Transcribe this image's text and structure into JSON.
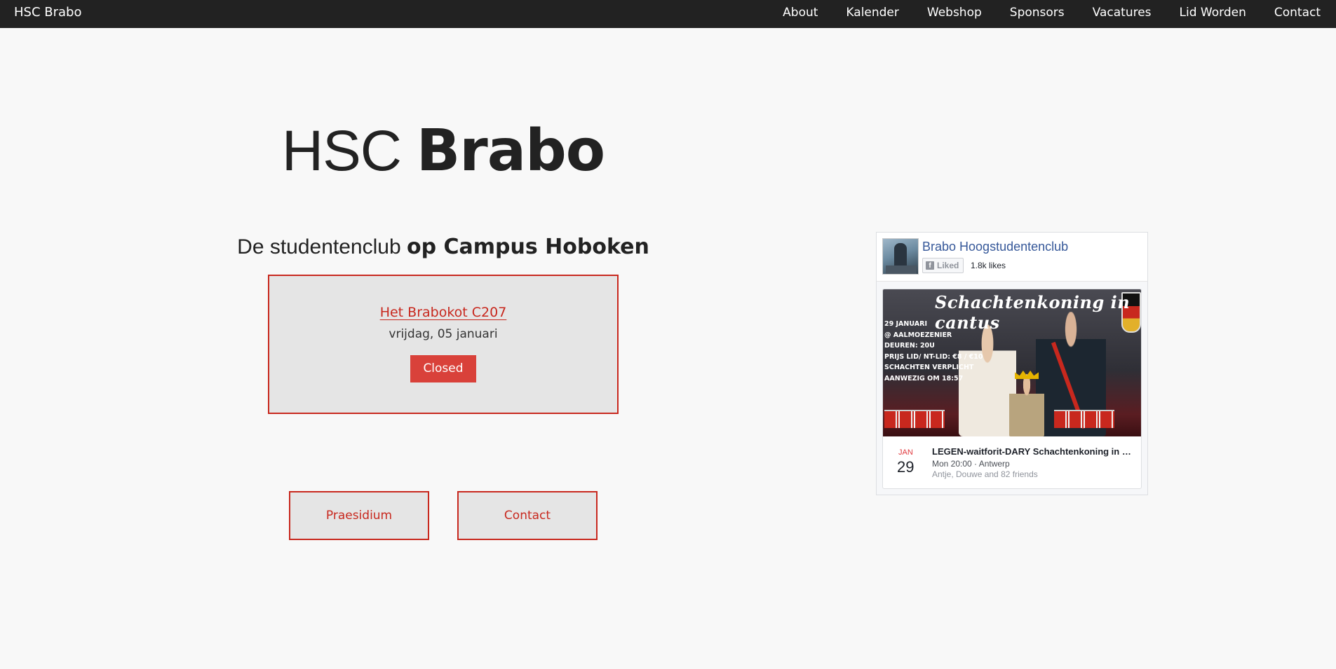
{
  "navbar": {
    "brand": "HSC Brabo",
    "links": [
      "About",
      "Kalender",
      "Webshop",
      "Sponsors",
      "Vacatures",
      "Lid Worden",
      "Contact"
    ]
  },
  "hero": {
    "title_light": "HSC ",
    "title_bold": "Brabo",
    "subtitle_light": "De studentenclub ",
    "subtitle_bold": "op Campus Hoboken"
  },
  "status": {
    "location": "Het Brabokot C207",
    "date": "vrijdag, 05 januari",
    "state": "Closed"
  },
  "buttons": {
    "praesidium": "Praesidium",
    "contact": "Contact"
  },
  "facebook": {
    "page_name": "Brabo Hoogstudentenclub",
    "liked_label": "Liked",
    "like_count": "1.8k likes",
    "cover": {
      "title": "Schachtenkoning in cantus",
      "lines": [
        "29 JANUARI",
        "@ AALMOEZENIER",
        "DEUREN: 20U",
        "PRIJS LID/ NT-LID: €8 / €10",
        "SCHACHTEN VERPLICHT",
        "AANWEZIG OM 18:57"
      ]
    },
    "event": {
      "month": "JAN",
      "day": "29",
      "title": "LEGEN-waitforit-DARY Schachtenkoning in cantus",
      "meta": "Mon 20:00 · Antwerp",
      "friends": "Antje, Douwe and 82 friends"
    }
  },
  "colors": {
    "navbar_bg": "#222222",
    "accent_red": "#c8281e",
    "closed_red": "#d9413a",
    "fb_blue": "#365899"
  }
}
